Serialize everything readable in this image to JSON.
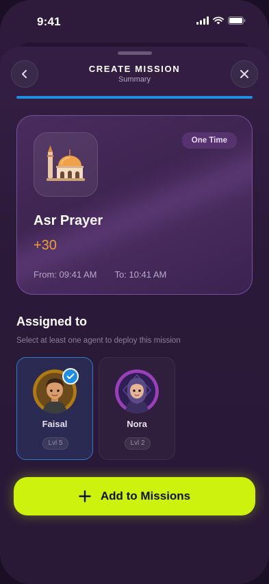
{
  "status_bar": {
    "time": "9:41"
  },
  "header": {
    "title": "CREATE MISSION",
    "subtitle": "Summary"
  },
  "progress": {
    "fraction": 1.0
  },
  "mission": {
    "badge": "One Time",
    "name": "Asr Prayer",
    "points": "+30",
    "from": "From: 09:41 AM",
    "to": "To: 10:41 AM",
    "icon": "mosque-icon"
  },
  "assigned": {
    "title": "Assigned to",
    "subtitle": "Select at least one agent to deploy this mission",
    "agents": [
      {
        "name": "Faisal",
        "level": "Lvl 5",
        "selected": true
      },
      {
        "name": "Nora",
        "level": "Lvl 2",
        "selected": false
      }
    ]
  },
  "action": {
    "label": "Add to Missions"
  },
  "colors": {
    "accent": "#ccf20e",
    "points": "#f5a623",
    "selection": "#1e8fe0"
  }
}
